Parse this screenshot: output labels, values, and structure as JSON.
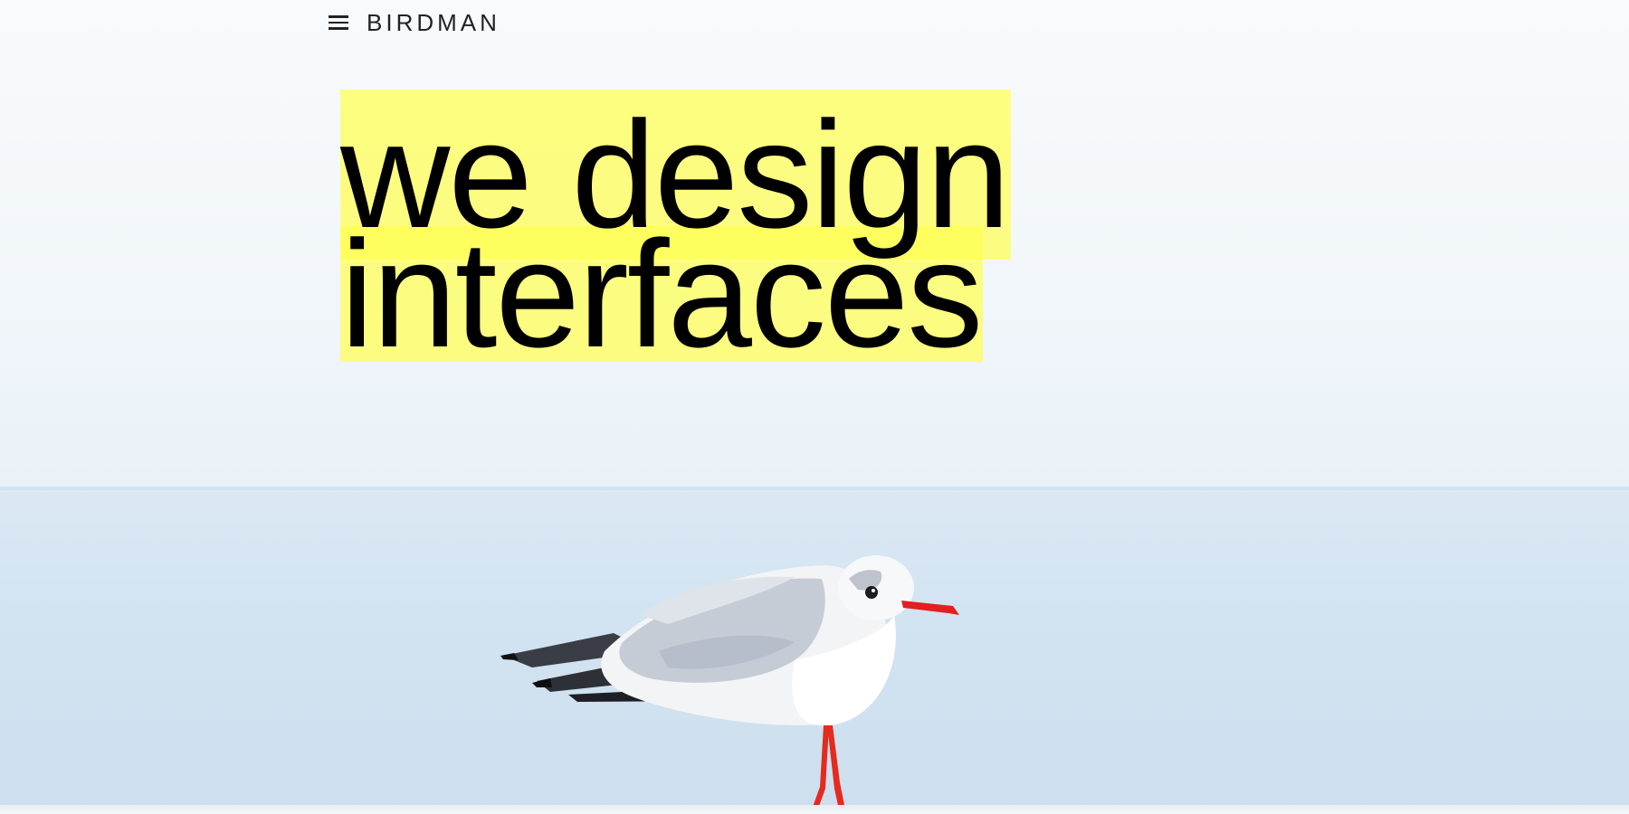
{
  "header": {
    "menu_icon": "hamburger-menu-icon",
    "brand": "BIRDMAN"
  },
  "hero": {
    "headline_line1": "we design",
    "headline_line2": "interfaces",
    "highlight_color": "#ffff50",
    "background_image": "seagull-on-rail-over-sea"
  }
}
